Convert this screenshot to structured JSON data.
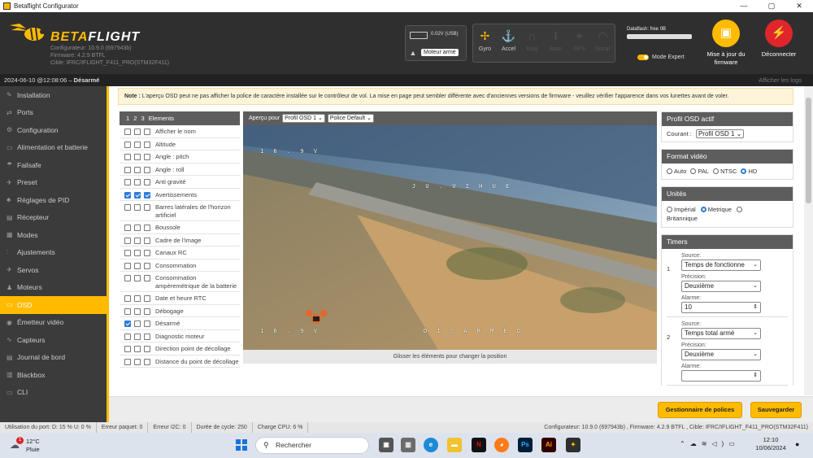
{
  "window": {
    "title": "Betaflight Configurator",
    "controls": [
      "—",
      "▢",
      "✕"
    ]
  },
  "header": {
    "logo_text_a": "BETA",
    "logo_text_b": "FLIGHT",
    "configurator": "Configurateur: 10.9.0 (697943b)",
    "firmware": "Firmware: 4.2.9 BTFL",
    "target": "Cible: IFRC/IFLIGHT_F411_PRO(STM32F411)",
    "battery_voltage": "0.02V (USB)",
    "armed_label": "Moteur armé",
    "sensors": [
      {
        "name": "Gyro",
        "icon": "gyro-icon",
        "active": true
      },
      {
        "name": "Accel",
        "icon": "accel-icon",
        "active": true
      },
      {
        "name": "Mag",
        "icon": "mag-icon",
        "active": false
      },
      {
        "name": "Baro",
        "icon": "baro-icon",
        "active": false
      },
      {
        "name": "GPS",
        "icon": "gps-icon",
        "active": false
      },
      {
        "name": "Sonar",
        "icon": "sonar-icon",
        "active": false
      }
    ],
    "dataflash": "Dataflash: free 0B",
    "expert_mode": "Mode Expert",
    "flash_button": "Mise à jour du firmware",
    "disconnect_button": "Déconnecter"
  },
  "subbar": {
    "datetime": "2024-06-10 @12:08:06 – ",
    "status": "Désarmé",
    "show_logs": "Afficher les logs"
  },
  "sidebar": {
    "items": [
      {
        "label": "Installation",
        "icon": "wrench-icon",
        "glyph": "✎"
      },
      {
        "label": "Ports",
        "icon": "ports-icon",
        "glyph": "⇄"
      },
      {
        "label": "Configuration",
        "icon": "gear-icon",
        "glyph": "⚙"
      },
      {
        "label": "Alimentation et batterie",
        "icon": "battery-icon",
        "glyph": "▭"
      },
      {
        "label": "Failsafe",
        "icon": "failsafe-icon",
        "glyph": "☂"
      },
      {
        "label": "Preset",
        "icon": "preset-icon",
        "glyph": "✈"
      },
      {
        "label": "Réglages de PID",
        "icon": "pid-icon",
        "glyph": "♣"
      },
      {
        "label": "Récepteur",
        "icon": "receiver-icon",
        "glyph": "▤"
      },
      {
        "label": "Modes",
        "icon": "modes-icon",
        "glyph": "▦"
      },
      {
        "label": "Ajustements",
        "icon": "adjustments-icon",
        "glyph": "⫶"
      },
      {
        "label": "Servos",
        "icon": "servos-icon",
        "glyph": "✈"
      },
      {
        "label": "Moteurs",
        "icon": "motors-icon",
        "glyph": "♟"
      },
      {
        "label": "OSD",
        "icon": "osd-icon",
        "glyph": "▭",
        "active": true
      },
      {
        "label": "Émetteur vidéo",
        "icon": "vtx-icon",
        "glyph": "◉"
      },
      {
        "label": "Capteurs",
        "icon": "sensors-icon",
        "glyph": "∿"
      },
      {
        "label": "Journal de bord",
        "icon": "logbook-icon",
        "glyph": "▤"
      },
      {
        "label": "Blackbox",
        "icon": "blackbox-icon",
        "glyph": "▥"
      },
      {
        "label": "CLI",
        "icon": "cli-icon",
        "glyph": "▭"
      }
    ]
  },
  "note": {
    "bold": "Note :",
    "text": " L'aperçu OSD peut ne pas afficher la police de caractère installée sur le contrôleur de vol. La mise en page peut sembler différente avec d'anciennes versions de firmware - veuillez vérifier l'apparence dans vos lunettes avant de voler."
  },
  "elements": {
    "header": "1 2 3 Elements",
    "rows": [
      {
        "label": "Afficher le nom",
        "checks": [
          false,
          false,
          false
        ]
      },
      {
        "label": "Altitude",
        "checks": [
          false,
          false,
          false
        ]
      },
      {
        "label": "Angle : pitch",
        "checks": [
          false,
          false,
          false
        ]
      },
      {
        "label": "Angle : roll",
        "checks": [
          false,
          false,
          false
        ]
      },
      {
        "label": "Anti gravité",
        "checks": [
          false,
          false,
          false
        ]
      },
      {
        "label": "Avertissements",
        "checks": [
          true,
          true,
          true
        ]
      },
      {
        "label": "Barres latérales de l'horizon artificiel",
        "checks": [
          false,
          false,
          false
        ]
      },
      {
        "label": "Boussole",
        "checks": [
          false,
          false,
          false
        ]
      },
      {
        "label": "Cadre de l'image",
        "checks": [
          false,
          false,
          false
        ]
      },
      {
        "label": "Canaux RC",
        "checks": [
          false,
          false,
          false
        ]
      },
      {
        "label": "Consommation",
        "checks": [
          false,
          false,
          false
        ]
      },
      {
        "label": "Consommation ampèremétrique de la batterie",
        "checks": [
          false,
          false,
          false
        ]
      },
      {
        "label": "Date et heure RTC",
        "checks": [
          false,
          false,
          false
        ]
      },
      {
        "label": "Débogage",
        "checks": [
          false,
          false,
          false
        ]
      },
      {
        "label": "Désarmé",
        "checks": [
          true,
          false,
          false
        ]
      },
      {
        "label": "Diagnostic moteur",
        "checks": [
          false,
          false,
          false
        ]
      },
      {
        "label": "Direction point de décollage",
        "checks": [
          false,
          false,
          false
        ]
      },
      {
        "label": "Distance du point de décollage",
        "checks": [
          false,
          false,
          false
        ]
      }
    ]
  },
  "preview": {
    "label": "Aperçu pour",
    "profile_select": "Profil OSD 1",
    "font_select": "Police Default",
    "osd_top_left": "1 6 . 9 V",
    "osd_center": "J U . U I H U E",
    "osd_bottom_left": "1 6 . 9 V",
    "osd_bottom_center": "D I S A R M E D",
    "footer": "Glisser les éléments pour changer la position"
  },
  "right_panels": {
    "profile": {
      "title": "Profil OSD actif",
      "current_label": "Courant :",
      "current_value": "Profil OSD 1"
    },
    "video_format": {
      "title": "Format vidéo",
      "options": [
        {
          "label": "Auto",
          "selected": false
        },
        {
          "label": "PAL",
          "selected": false
        },
        {
          "label": "NTSC",
          "selected": false
        },
        {
          "label": "HD",
          "selected": true
        }
      ]
    },
    "units": {
      "title": "Unités",
      "imperial": "Impérial",
      "metric": "Metrique",
      "british": "Britannique"
    },
    "timers": {
      "title": "Timers",
      "source_label": "Source:",
      "precision_label": "Précision:",
      "alarm_label": "Alarme:",
      "items": [
        {
          "num": "1",
          "source": "Temps de fonctionne",
          "precision": "Deuxième",
          "alarm": "10"
        },
        {
          "num": "2",
          "source": "Temps total armé",
          "precision": "Deuxième",
          "alarm": ""
        }
      ]
    }
  },
  "buttons": {
    "font_manager": "Gestionnaire de polices",
    "save": "Sauvegarder"
  },
  "statusbar": {
    "port": "Utilisation du port: D: 15 % U: 0 %",
    "packet_err": "Erreur paquet: 0",
    "i2c_err": "Erreur I2C: 0",
    "cycle": "Durée de cycle: 250",
    "cpu": "Charge CPU: 6 %",
    "right": "Configurateur: 10.9.0 (697943b) , Firmware: 4.2.9 BTFL , Cible: IFRC/IFLIGHT_F411_PRO(STM32F411)"
  },
  "taskbar": {
    "weather_temp": "12°C",
    "weather_desc": "Pluie",
    "weather_badge": "1",
    "search": "Rechercher",
    "time": "12:10",
    "date": "10/06/2024"
  },
  "colors": {
    "accent": "#ffbb00",
    "sidebar": "#3b3b3b",
    "header": "#2f2f2f",
    "disconnect": "#e0262b"
  }
}
